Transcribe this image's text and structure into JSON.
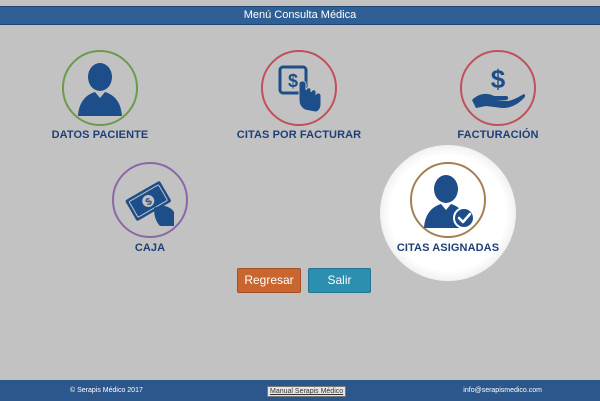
{
  "header": {
    "title": "Menú Consulta Médica"
  },
  "menu": {
    "datos_paciente": "DATOS PACIENTE",
    "citas_por_facturar": "CITAS POR FACTURAR",
    "facturacion": "FACTURACIÓN",
    "caja": "CAJA",
    "citas_asignadas": "CITAS ASIGNADAS"
  },
  "buttons": {
    "regresar": "Regresar",
    "salir": "Salir"
  },
  "footer": {
    "copyright": "© Serapis Médico 2017",
    "manual": "Manual Serapis Médico",
    "email": "info@serapismedico.com"
  },
  "colors": {
    "icon_blue": "#1d4e89",
    "ring_green": "#6b9a4a",
    "ring_red": "#c0505a",
    "ring_purple": "#8a68a8",
    "ring_tan": "#a38155",
    "regresar": "#c9652e",
    "salir": "#2d8fb0"
  },
  "icons": [
    "person-icon",
    "dollar-hand-icon",
    "money-hand-icon",
    "cash-icon",
    "person-check-icon"
  ]
}
